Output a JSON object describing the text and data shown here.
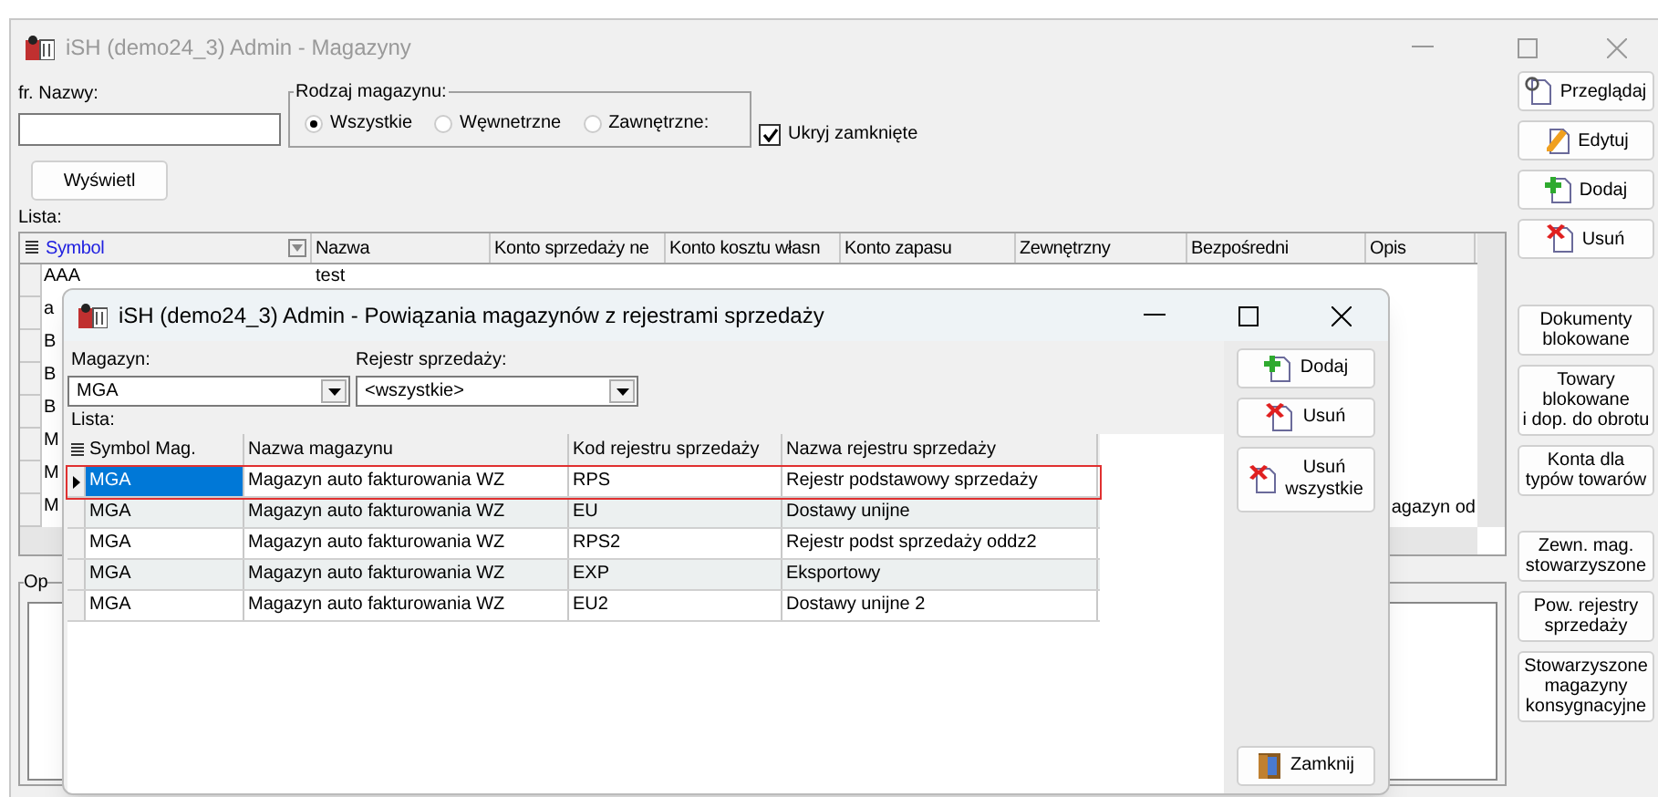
{
  "window": {
    "title": "iSH (demo24_3) Admin - Magazyny"
  },
  "filter": {
    "name_label": "fr. Nazwy:",
    "group_label": "Rodzaj magazynu:",
    "radios": [
      {
        "label": "Wszystkie",
        "selected": true
      },
      {
        "label": "Węwnetrzne",
        "selected": false
      },
      {
        "label": "Zawnętrzne:",
        "selected": false
      }
    ],
    "hide_closed": {
      "label": "Ukryj zamknięte",
      "checked": true
    },
    "show_button": "Wyświetl"
  },
  "list_label": "Lista:",
  "table": {
    "columns": [
      "Symbol",
      "Nazwa",
      "Konto sprzedaży ne",
      "Konto kosztu własn",
      "Konto zapasu",
      "Zewnętrzny",
      "Bezpośredni",
      "Opis"
    ],
    "rows": [
      {
        "symbol": "AAA",
        "nazwa": "test"
      },
      {
        "symbol": "a"
      },
      {
        "symbol": "B"
      },
      {
        "symbol": "B"
      },
      {
        "symbol": "B"
      },
      {
        "symbol": "M"
      },
      {
        "symbol": "M"
      },
      {
        "symbol": "M",
        "opis": "agazyn od"
      }
    ]
  },
  "notes_label": "Op",
  "side_buttons": [
    {
      "label": "Przeglądaj",
      "kind": "view"
    },
    {
      "label": "Edytuj",
      "kind": "edit"
    },
    {
      "label": "Dodaj",
      "kind": "add"
    },
    {
      "label": "Usuń",
      "kind": "delete"
    },
    {
      "label": "Dokumenty\nblokowane",
      "kind": "text"
    },
    {
      "label": "Towary\nblokowane\ni dop. do obrotu",
      "kind": "text"
    },
    {
      "label": "Konta dla\ntypów towarów",
      "kind": "text"
    },
    {
      "label": "Zewn. mag.\nstowarzyszone",
      "kind": "text"
    },
    {
      "label": "Pow. rejestry\nsprzedaży",
      "kind": "text"
    },
    {
      "label": "Stowarzyszone\nmagazyny\nkonsygnacyjne",
      "kind": "text"
    }
  ],
  "dialog": {
    "title": "iSH (demo24_3) Admin - Powiązania magazynów z rejestrami sprzedaży",
    "warehouse_label": "Magazyn:",
    "warehouse_value": "MGA",
    "register_label": "Rejestr sprzedaży:",
    "register_value": "<wszystkie>",
    "list_label": "Lista:",
    "columns": [
      "Symbol Mag.",
      "Nazwa magazynu",
      "Kod rejestru sprzedaży",
      "Nazwa rejestru sprzedaży"
    ],
    "rows": [
      {
        "cells": [
          "MGA",
          "Magazyn auto fakturowania WZ",
          "RPS",
          "Rejestr podstawowy sprzedaży"
        ],
        "selected": true
      },
      {
        "cells": [
          "MGA",
          "Magazyn auto fakturowania WZ",
          "EU",
          "Dostawy unijne"
        ],
        "selected": false
      },
      {
        "cells": [
          "MGA",
          "Magazyn auto fakturowania WZ",
          "RPS2",
          "Rejestr podst sprzedaży oddz2"
        ],
        "selected": false
      },
      {
        "cells": [
          "MGA",
          "Magazyn auto fakturowania WZ",
          "EXP",
          "Eksportowy"
        ],
        "selected": false
      },
      {
        "cells": [
          "MGA",
          "Magazyn auto fakturowania WZ",
          "EU2",
          "Dostawy unijne 2"
        ],
        "selected": false
      }
    ],
    "buttons": [
      {
        "label": "Dodaj",
        "kind": "add"
      },
      {
        "label": "Usuń",
        "kind": "delete"
      },
      {
        "label": "Usuń\nwszystkie",
        "kind": "delete"
      },
      {
        "label": "Zamknij",
        "kind": "close"
      }
    ]
  }
}
